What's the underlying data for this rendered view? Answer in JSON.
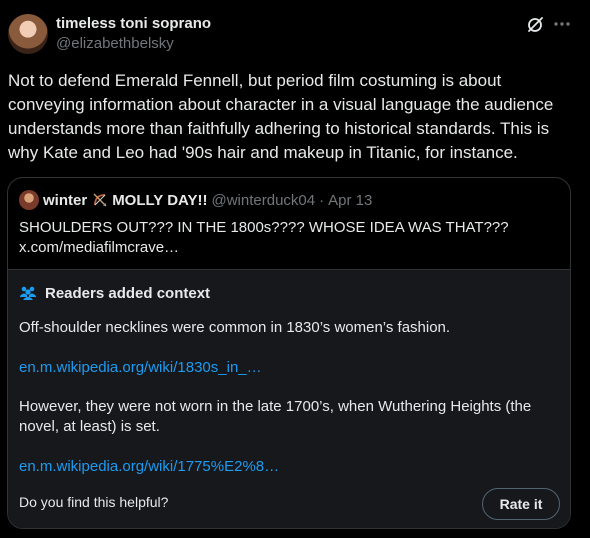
{
  "author": {
    "name": "timeless toni soprano",
    "handle": "@elizabethbelsky",
    "avatar_icon": "avatar-woman-curly-hair"
  },
  "header_icons": [
    "grok-icon",
    "more-icon"
  ],
  "post": {
    "text": "Not to defend Emerald Fennell, but period film costuming is about conveying information about character in a visual language the audience understands more than faithfully adhering to historical standards. This is why Kate and Leo had '90s hair and makeup in Titanic, for instance."
  },
  "quote": {
    "name": "winter",
    "name_suffix": "MOLLY DAY!!",
    "name_emoji_icon": "bow-and-arrow-icon",
    "handle": "@winterduck04",
    "separator": "·",
    "date": "Apr 13",
    "text": "SHOULDERS OUT??? IN THE 1800s???? WHOSE IDEA WAS THAT???",
    "link": "x.com/mediafilmcrave…"
  },
  "community_note": {
    "title": "Readers added context",
    "icon": "people-icon",
    "paragraph1": "Off-shoulder necklines were common in 1830’s women’s fashion.",
    "link1": "en.m.wikipedia.org/wiki/1830s_in_…",
    "paragraph2": "However, they were not worn in the late 1700’s, when Wuthering Heights (the novel, at least) is set.",
    "link2": "en.m.wikipedia.org/wiki/1775%E2%8…",
    "helpful_prompt": "Do you find this helpful?",
    "rate_label": "Rate it"
  },
  "colors": {
    "background": "#000000",
    "text": "#e7e9ea",
    "secondary": "#71767b",
    "link": "#1d9bf0",
    "note_bg": "#16181c",
    "border": "#2f3336"
  }
}
